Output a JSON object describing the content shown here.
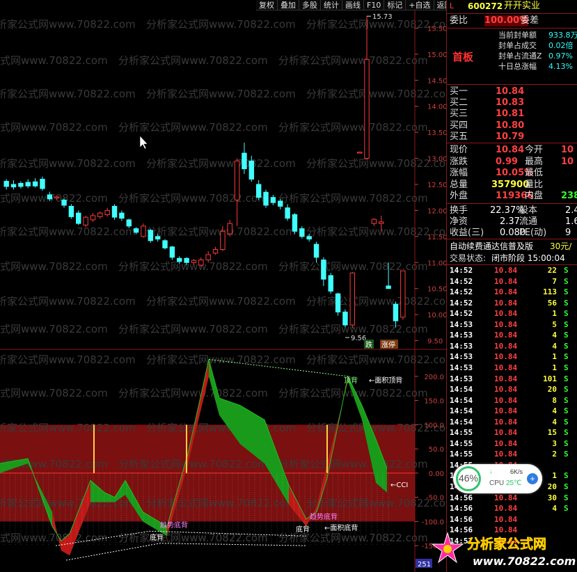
{
  "toolbar": [
    "复权",
    "叠加",
    "多股",
    "统计",
    "画线",
    "F10",
    "标记",
    "+自选",
    "返回"
  ],
  "price_axis": [
    "15.50",
    "15.00",
    "14.50",
    "14.00",
    "13.50",
    "13.00",
    "12.50",
    "12.00",
    "11.50",
    "11.00",
    "10.50",
    "10.00",
    "9.50"
  ],
  "cci_axis": [
    "200.0",
    "150.0",
    "100.0",
    "50.0",
    "0.00",
    "-50.0",
    "-100.0",
    "-150.0"
  ],
  "annotations": {
    "high": "15.73",
    "low": "9.56",
    "die": "跌",
    "zhangting": "涨停",
    "top_div": "顶背",
    "area_top_div": "←面积顶背",
    "trend_bottom_div_1": "趋势底背",
    "bottom_div_1": "底背",
    "trend_bottom_div_2": "趋势底背",
    "bottom_div_2": "底背",
    "area_bottom_div": "←面积底背",
    "cci": "←CCI",
    "corner": "251"
  },
  "watermark": "分析家公式网www.70822.com",
  "chart_data": {
    "type": "candlestick",
    "ylim": [
      9.4,
      15.8
    ],
    "candles": [
      [
        12.56,
        12.46,
        12.6,
        12.4
      ],
      [
        12.5,
        12.45,
        12.58,
        12.4
      ],
      [
        12.52,
        12.46,
        12.56,
        12.42
      ],
      [
        12.54,
        12.47,
        12.6,
        12.43
      ],
      [
        12.55,
        12.47,
        12.62,
        12.44
      ],
      [
        12.6,
        12.42,
        12.65,
        12.38
      ],
      [
        12.3,
        12.22,
        12.36,
        12.18
      ],
      [
        12.24,
        12.26,
        12.28,
        12.2
      ],
      [
        12.2,
        12.1,
        12.23,
        12.05
      ],
      [
        12.08,
        11.88,
        12.12,
        11.84
      ],
      [
        11.95,
        11.75,
        12.0,
        11.72
      ],
      [
        11.72,
        11.87,
        11.9,
        11.68
      ],
      [
        11.82,
        11.9,
        11.95,
        11.78
      ],
      [
        11.88,
        11.95,
        11.98,
        11.84
      ],
      [
        11.92,
        12.0,
        12.05,
        11.88
      ],
      [
        12.08,
        11.87,
        12.12,
        11.82
      ],
      [
        11.95,
        11.85,
        12.0,
        11.8
      ],
      [
        11.82,
        11.7,
        11.84,
        11.66
      ],
      [
        11.65,
        11.58,
        11.68,
        11.54
      ],
      [
        11.5,
        11.7,
        11.75,
        11.48
      ],
      [
        11.62,
        11.42,
        11.65,
        11.38
      ],
      [
        11.5,
        11.45,
        11.55,
        11.4
      ],
      [
        11.42,
        11.28,
        11.45,
        11.25
      ],
      [
        11.3,
        11.1,
        11.32,
        11.05
      ],
      [
        11.08,
        11.02,
        11.12,
        10.98
      ],
      [
        11.08,
        11.0,
        11.1,
        10.95
      ],
      [
        11.0,
        11.04,
        11.07,
        10.96
      ],
      [
        10.95,
        11.05,
        11.1,
        10.92
      ],
      [
        11.05,
        11.15,
        11.22,
        11.0
      ],
      [
        11.18,
        11.25,
        11.3,
        11.15
      ],
      [
        11.25,
        11.6,
        11.7,
        11.22
      ],
      [
        11.55,
        11.75,
        11.82,
        11.5
      ],
      [
        12.2,
        12.95,
        13.0,
        11.7
      ],
      [
        13.1,
        12.8,
        13.3,
        12.7
      ],
      [
        12.95,
        12.6,
        13.05,
        12.55
      ],
      [
        12.5,
        12.25,
        12.58,
        12.2
      ],
      [
        12.35,
        12.1,
        12.4,
        12.05
      ],
      [
        12.25,
        12.15,
        12.3,
        12.1
      ],
      [
        12.18,
        12.08,
        12.23,
        12.02
      ],
      [
        12.05,
        11.85,
        12.12,
        11.8
      ],
      [
        11.92,
        11.6,
        11.95,
        11.55
      ],
      [
        11.65,
        11.5,
        11.7,
        11.46
      ],
      [
        11.5,
        11.45,
        11.55,
        11.4
      ],
      [
        11.35,
        11.1,
        11.4,
        11.0
      ],
      [
        11.05,
        10.68,
        11.1,
        10.55
      ],
      [
        10.75,
        10.45,
        10.8,
        10.4
      ],
      [
        10.4,
        10.05,
        10.42,
        9.98
      ],
      [
        10.05,
        9.8,
        10.1,
        9.76
      ],
      [
        9.8,
        10.8,
        10.82,
        9.74
      ],
      [
        13.1,
        13.12,
        13.12,
        13.1
      ],
      [
        13.0,
        14.9,
        15.73,
        12.98
      ],
      [
        11.75,
        11.83,
        11.85,
        11.7
      ],
      [
        11.75,
        11.78,
        11.9,
        11.6
      ],
      [
        10.55,
        10.5,
        11.0,
        10.5
      ],
      [
        10.2,
        9.88,
        10.25,
        9.75
      ],
      [
        9.95,
        10.84,
        10.84,
        9.9
      ]
    ]
  },
  "panel": {
    "code": "600272",
    "name": "开开实业",
    "wb_label": "委比",
    "wb_value": "100.00%",
    "wc_label": "委差",
    "info_rows": [
      {
        "label": "当前封单额",
        "value": "933.8万"
      },
      {
        "label": "封单占成交",
        "value": "0.02倍"
      },
      {
        "label": "封单占流通Z",
        "value": "0.97%"
      },
      {
        "label": "十日总涨幅",
        "value": "4.13%"
      }
    ],
    "first_board": "首板",
    "bids": [
      {
        "label": "买一",
        "price": "10.84"
      },
      {
        "label": "买二",
        "price": "10.83"
      },
      {
        "label": "买三",
        "price": "10.81"
      },
      {
        "label": "买四",
        "price": "10.80"
      },
      {
        "label": "买五",
        "price": "10.79"
      }
    ],
    "quote": [
      {
        "l1": "现价",
        "v1": "10.84",
        "l2": "今开",
        "v2": "10"
      },
      {
        "l1": "涨跌",
        "v1": "0.99",
        "l2": "最高",
        "v2": "10"
      },
      {
        "l1": "涨幅",
        "v1": "10.05%",
        "l2": "最低",
        "v2": ""
      },
      {
        "l1": "总量",
        "v1": "357900",
        "l2": "量比",
        "v2": ""
      },
      {
        "l1": "外盘",
        "v1": "119366",
        "l2": "内盘",
        "v2": "238"
      }
    ],
    "stats": [
      {
        "l1": "换手",
        "v1": "22.37%",
        "l2": "股本",
        "v2": "2.4"
      },
      {
        "l1": "净资",
        "v1": "2.37",
        "l2": "流通",
        "v2": "1.6"
      },
      {
        "l1": "收益(三)",
        "v1": "0.080",
        "l2": "PE(动)",
        "v2": "9"
      }
    ],
    "promo": "自动续费通达信普及版",
    "promo_price": "30元/",
    "trade_status_label": "交易状态:",
    "trade_status": "闭市阶段 15:00:04",
    "trades": [
      [
        "14:52",
        "10.84",
        "22",
        "S"
      ],
      [
        "14:52",
        "10.84",
        "7",
        "S"
      ],
      [
        "14:52",
        "10.84",
        "113",
        "S"
      ],
      [
        "14:52",
        "10.84",
        "56",
        "S"
      ],
      [
        "14:52",
        "10.84",
        "1",
        "S"
      ],
      [
        "14:53",
        "10.84",
        "5",
        "S"
      ],
      [
        "14:53",
        "10.84",
        "4",
        "S"
      ],
      [
        "14:53",
        "10.84",
        "4",
        "S"
      ],
      [
        "14:53",
        "10.84",
        "1",
        "S"
      ],
      [
        "14:53",
        "10.84",
        "1",
        "S"
      ],
      [
        "14:53",
        "10.84",
        "101",
        "S"
      ],
      [
        "14:54",
        "10.84",
        "20",
        "S"
      ],
      [
        "14:54",
        "10.84",
        "8",
        "S"
      ],
      [
        "14:54",
        "10.84",
        "4",
        "S"
      ],
      [
        "14:54",
        "10.84",
        "4",
        "S"
      ],
      [
        "14:55",
        "10.84",
        "15",
        "S"
      ],
      [
        "14:55",
        "10.84",
        "3",
        "S"
      ],
      [
        "14:55",
        "10.84",
        "2",
        "S"
      ],
      [
        "14:55",
        "10.84",
        "",
        ""
      ],
      [
        "14:56",
        "10.84",
        "1",
        "S"
      ],
      [
        "14:56",
        "10.84",
        "20",
        "S"
      ],
      [
        "14:56",
        "10.84",
        "30",
        "S"
      ],
      [
        "14:56",
        "10.84",
        "4",
        "S"
      ],
      [
        "14:56",
        "10.84",
        "",
        ""
      ],
      [
        "14:56",
        "10.84",
        "",
        ""
      ],
      [
        "14:57",
        "10.84",
        "",
        ""
      ]
    ]
  },
  "cpu_widget": {
    "percent": "46%",
    "speed": "6K/s",
    "cpu_label": "CPU",
    "temp": "25℃"
  },
  "logo": {
    "text": "分析家公式网",
    "url": "www.70822.com"
  }
}
